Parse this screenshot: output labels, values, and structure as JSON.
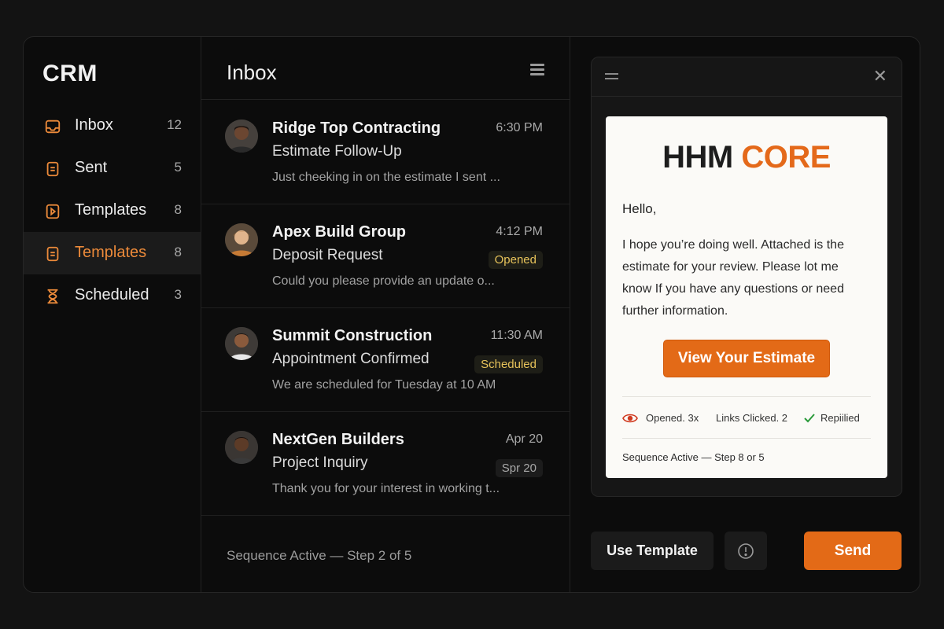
{
  "sidebar": {
    "brand": "CRM",
    "items": [
      {
        "label": "Inbox",
        "count": "12",
        "icon": "inbox-icon"
      },
      {
        "label": "Sent",
        "count": "5",
        "icon": "document-icon"
      },
      {
        "label": "Templates",
        "count": "8",
        "icon": "play-icon"
      },
      {
        "label": "Templates",
        "count": "8",
        "icon": "document-icon"
      },
      {
        "label": "Scheduled",
        "count": "3",
        "icon": "hourglass-icon"
      }
    ],
    "accent": "#ec8a3a"
  },
  "inbox": {
    "title": "Inbox",
    "messages": [
      {
        "sender": "Ridge Top Contracting",
        "time": "6:30 PM",
        "subject": "Estimate Follow-Up",
        "preview": "Just cheeking in on the estimate I sent ...",
        "badge": ""
      },
      {
        "sender": "Apex Build Group",
        "time": "4:12 PM",
        "subject": "Deposit Request",
        "preview": "Could you please provide an update o...",
        "badge": "Opened"
      },
      {
        "sender": "Summit Construction",
        "time": "11:30 AM",
        "subject": "Appointment Confirmed",
        "preview": "We are scheduled for Tuesday at 10 AM",
        "badge": "Scheduled"
      },
      {
        "sender": "NextGen Builders",
        "time": "Apr 20",
        "subject": "Project Inquiry",
        "preview": "Thank you for your interest in working t...",
        "badge": "Spr 20"
      }
    ],
    "footer": "Sequence Active — Step 2 of 5"
  },
  "preview": {
    "logo_part1": "HHM",
    "logo_part2": "CORE",
    "greeting": "Hello,",
    "body": "I hope you’re doing well. Attached is the estimate for your review. Please lot me know If you have any questions or need further information.",
    "cta": "View Your Estimate",
    "stats": {
      "opened": "Opened. 3x",
      "links": "Links Clicked. 2",
      "replied": "Repiilied"
    },
    "sequence": "Sequence Active — Step 8 or 5",
    "brand_color": "#e4691a"
  },
  "actions": {
    "use_template": "Use Template",
    "send": "Send"
  }
}
